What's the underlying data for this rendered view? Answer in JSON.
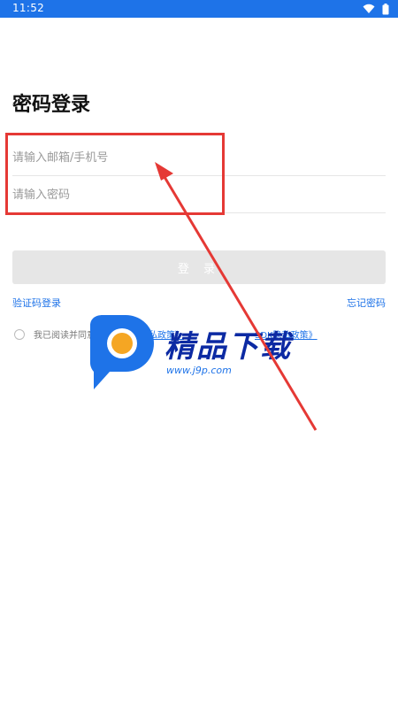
{
  "status_bar": {
    "time": "11:52",
    "icons": [
      "wifi-icon",
      "battery-icon"
    ]
  },
  "login": {
    "title": "密码登录",
    "email_placeholder": "请输入邮箱/手机号",
    "password_placeholder": "请输入密码",
    "login_button": "登 录",
    "sms_login": "验证码登录",
    "forgot_password": "忘记密码",
    "agreement_text": "我已阅读并同意",
    "policy_1": "《隐私政策》",
    "policy_2": "SDK隐私政策》"
  },
  "watermark": {
    "brand": "精品下载",
    "url": "www.j9p.com"
  },
  "colors": {
    "accent": "#1e73e8",
    "annotation": "#e53935",
    "button_disabled": "#e6e6e6"
  }
}
